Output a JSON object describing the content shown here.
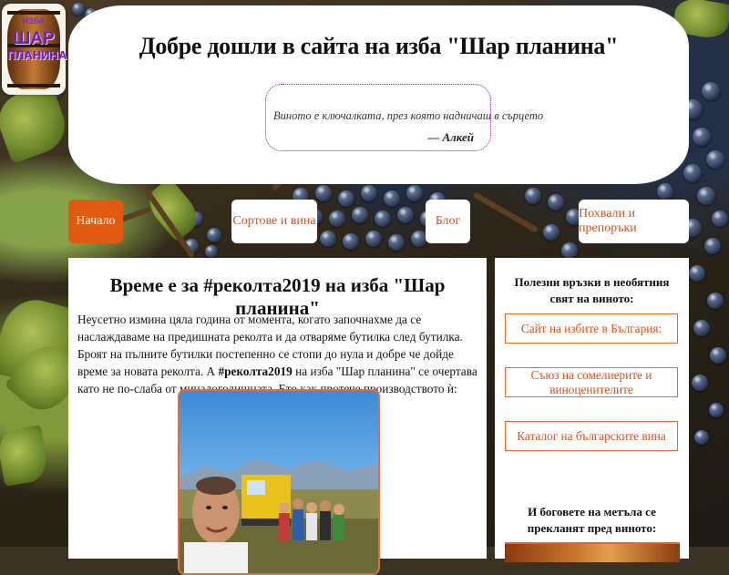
{
  "logo": {
    "top_text": "ИЗБА",
    "mid_text": "ШАР",
    "bottom_text": "ПЛАНИНА"
  },
  "header": {
    "title": "Добре дошли в сайта на изба \"Шар планина\"",
    "quote": "Виното е ключалката, през която надничаш в сърцето",
    "quote_author": "—  Алкей"
  },
  "nav": {
    "items": [
      {
        "label": "Начало",
        "active": true
      },
      {
        "label": "Сортове и вина",
        "active": false
      },
      {
        "label": "Блог",
        "active": false
      },
      {
        "label": "Похвали и препоръки",
        "active": false
      }
    ]
  },
  "article": {
    "title": "Време е за #реколта2019 на изба \"Шар планина\"",
    "body_part1": "Неусетно измина цяла година от момента, когато започнахме да се наслаждаваме на предишната реколта и да отваряме бутилка след бутилка. Броят на пълните бутилки постепенно се стопи до нула и добре че дойде време за новата реколта. А ",
    "body_hashtag": "#реколта2019",
    "body_part2": " на изба \"Шар планина\" се очертава като не по-слаба от миналогодишната. Ето как протече производството ѝ:"
  },
  "sidebar": {
    "title": "Полезни връзки в необятния свят на виното:",
    "links": [
      "Сайт на избите в България:",
      "Съюз на сомелиерите и виноценителите",
      "Каталог на българските вина"
    ],
    "title2": "И боговете на метъла се прекланят пред виното:"
  },
  "colors": {
    "accent": "#e05a12",
    "link": "#d6521a",
    "quote_border": "#8a1d8a"
  }
}
